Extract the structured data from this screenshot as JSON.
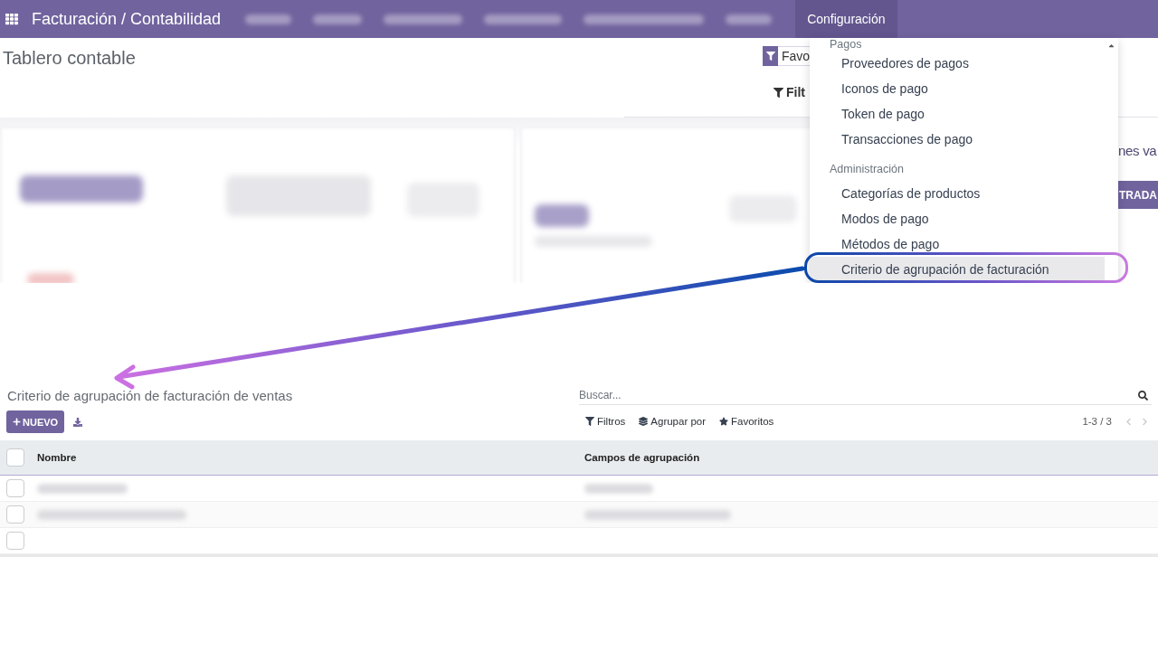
{
  "navbar": {
    "app_title": "Facturación / Contabilidad",
    "menus": [
      {
        "redacted": true,
        "selected": false
      },
      {
        "redacted": true,
        "selected": false
      },
      {
        "redacted": true,
        "selected": false
      },
      {
        "redacted": true,
        "selected": false
      },
      {
        "redacted": true,
        "selected": false
      },
      {
        "redacted": true,
        "selected": false
      },
      {
        "label": "Configuración",
        "redacted": false,
        "selected": true
      }
    ]
  },
  "dashboard": {
    "title": "Tablero contable",
    "facet": "Favo",
    "filters_button": "Filt",
    "journal_title": "nes va",
    "journal_button": "TRADA"
  },
  "config_menu": {
    "sections": [
      {
        "header": "Pagos",
        "items": [
          {
            "label": "Proveedores de pagos",
            "selected": false
          },
          {
            "label": "Iconos de pago",
            "selected": false
          },
          {
            "label": "Token de pago",
            "selected": false
          },
          {
            "label": "Transacciones de pago",
            "selected": false
          }
        ]
      },
      {
        "header": "Administración",
        "items": [
          {
            "label": "Categorías de productos",
            "selected": false
          },
          {
            "label": "Modos de pago",
            "selected": false
          },
          {
            "label": "Métodos de pago",
            "selected": false
          },
          {
            "label": "Criterio de agrupación de facturación",
            "selected": true
          }
        ]
      }
    ]
  },
  "list_view": {
    "title": "Criterio de agrupación de facturación de ventas",
    "new_button": "NUEVO",
    "search": {
      "placeholder": "Buscar..."
    },
    "search_options": [
      {
        "kind": "filter",
        "label": "Filtros"
      },
      {
        "kind": "group",
        "label": "Agrupar por"
      },
      {
        "kind": "favorite",
        "label": "Favoritos"
      }
    ],
    "pager": "1-3 / 3",
    "columns": [
      "Nombre",
      "Campos de agrupación"
    ],
    "select_all_checked": false,
    "rows": [
      {
        "checked": false,
        "redacted": true
      },
      {
        "checked": false,
        "redacted": true
      },
      {
        "checked": false,
        "redacted": false
      }
    ]
  },
  "annotation": {
    "highlight_ring": true,
    "arrow": true
  }
}
